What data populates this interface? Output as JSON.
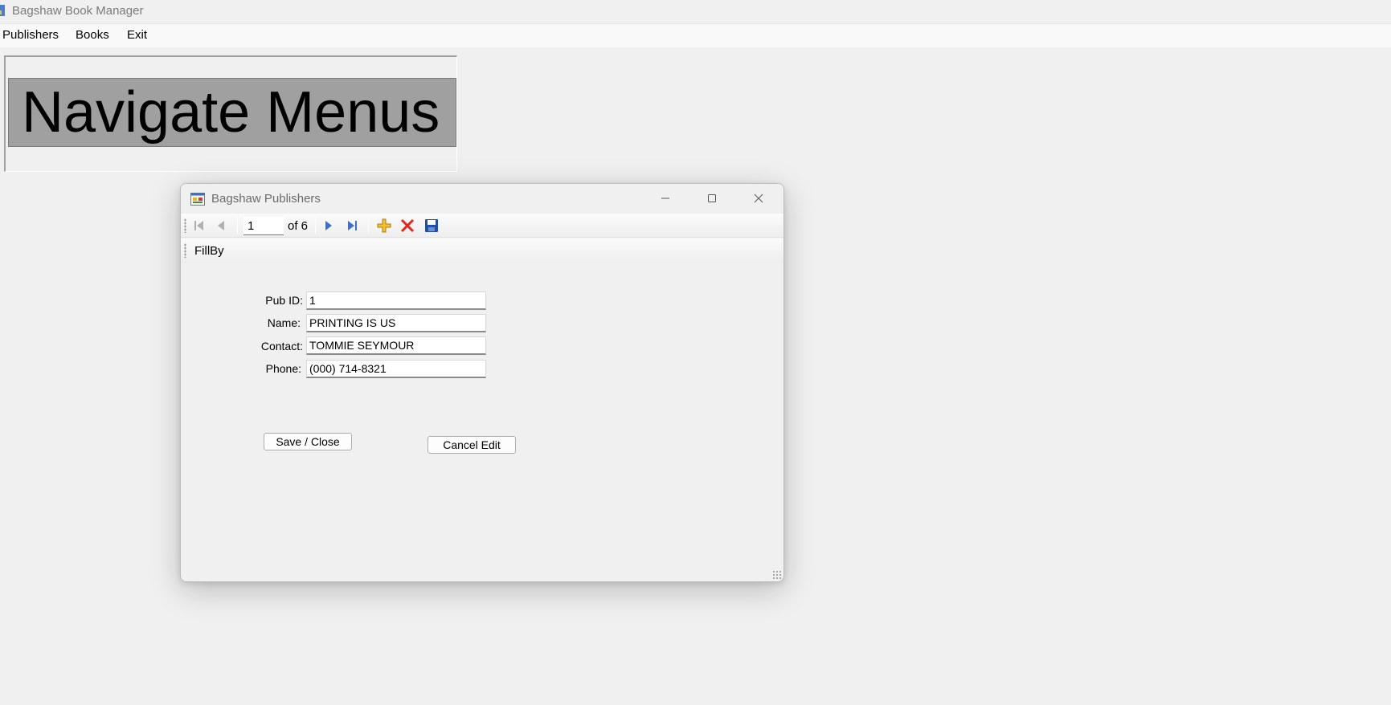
{
  "main_window": {
    "title": "Bagshaw Book Manager"
  },
  "menubar": {
    "items": [
      {
        "label": "Publishers"
      },
      {
        "label": "Books"
      },
      {
        "label": "Exit"
      }
    ]
  },
  "nav_panel": {
    "label": "Navigate Menus"
  },
  "child_window": {
    "title": "Bagshaw Publishers",
    "caption_buttons": [
      "minimize-icon",
      "maximize-icon",
      "close-icon"
    ],
    "navigator": {
      "position": "1",
      "count_label": "of 6",
      "icons": [
        "move-first-icon",
        "move-previous-icon",
        "move-next-icon",
        "move-last-icon",
        "add-new-icon",
        "delete-icon",
        "save-icon"
      ]
    },
    "fillby_toolbar": {
      "label": "FillBy"
    },
    "form": {
      "pub_id": {
        "label": "Pub ID:",
        "value": "1"
      },
      "name": {
        "label": "Name:",
        "value": "PRINTING IS US"
      },
      "contact": {
        "label": "Contact:",
        "value": "TOMMIE SEYMOUR"
      },
      "phone": {
        "label": "Phone:",
        "value": "(000) 714-8321"
      }
    },
    "buttons": {
      "save_close": "Save / Close",
      "cancel_edit": "Cancel Edit"
    }
  },
  "colors": {
    "background": "#f0f0f0",
    "nav_label_bg": "#a0a0a0",
    "navigator_blue": "#3a6fd8",
    "add_icon": "#e8b420",
    "delete_icon": "#e0281e",
    "save_icon": "#1f4fa8"
  }
}
